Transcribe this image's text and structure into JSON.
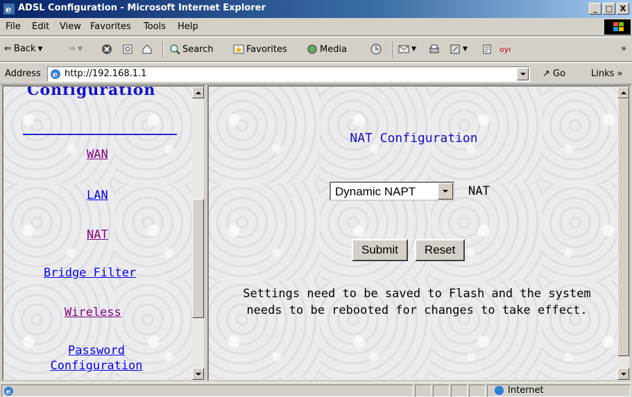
{
  "window": {
    "title": "ADSL Configuration - Microsoft Internet Explorer",
    "buttons": [
      "_",
      "□",
      "X"
    ]
  },
  "menu": [
    "File",
    "Edit",
    "View",
    "Favorites",
    "Tools",
    "Help"
  ],
  "toolbar": {
    "back": "Back",
    "search": "Search",
    "favorites": "Favorites",
    "media": "Media"
  },
  "address": {
    "label": "Address",
    "url": "http://192.168.1.1",
    "go": "Go",
    "links": "Links"
  },
  "nav": {
    "heading": "Configuration",
    "items": [
      {
        "label": "WAN",
        "visited": true
      },
      {
        "label": "LAN",
        "visited": false
      },
      {
        "label": "NAT",
        "visited": true
      },
      {
        "label": "Bridge Filter",
        "visited": false
      },
      {
        "label": "Wireless",
        "visited": true
      },
      {
        "label": "Password Configuration",
        "visited": false
      }
    ]
  },
  "page": {
    "title": "NAT Configuration",
    "nat_mode_value": "Dynamic NAPT",
    "nat_label": "NAT",
    "submit": "Submit",
    "reset": "Reset",
    "note": "Settings need to be saved to Flash and the system needs to be rebooted for changes to take effect."
  },
  "status": {
    "zone": "Internet"
  },
  "colors": {
    "link": "#0000ee",
    "visited": "#800080",
    "title_blue": "#1111bb",
    "titlebar": "#0a246a"
  }
}
